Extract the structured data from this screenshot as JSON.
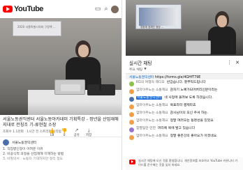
{
  "left": {
    "brand": "YouTube",
    "banner": "2020 서울특별시의회 구정책 ...",
    "title": "서울노동권익센터 서울노동아카데미 기획특강 - 정년을 산업재해 지대로 전칭조 기-류현철 소장",
    "meta": "조회수 1.1천회 · 1시간 전 스트리밍 시작됨",
    "actions": [
      {
        "glyph": "👍",
        "label": "18"
      },
      {
        "glyph": "👎",
        "label": "0"
      },
      {
        "glyph": "↗",
        "label": "공유"
      },
      {
        "glyph": "⤓",
        "label": "저장"
      }
    ],
    "desc_channel": "서울노동권익센터",
    "desc_lines": [
      "1. 직업병인정이 어려운 이유",
      "2. 비공식적 과정을 산업재해 이해하는 방법",
      "3. 비질의서 : 노동자 기대하지만 정리 정도"
    ]
  },
  "right": {
    "screen_text": "정동에 정해진 청정 ...",
    "chat": {
      "title": "실시간 채팅",
      "subtitle": "주요 채팅",
      "pinned_channel": "서울노동권익센터",
      "pinned_text": "https://forms.gle/4GHfT79E",
      "messages": [
        {
          "author": "KG의 여행자 레디오",
          "text": "반갑습니다. 잘부탁드립니다",
          "style": "normal",
          "color": "#8bc34a"
        },
        {
          "author": "엄마이주노는 소통해요",
          "text": "감자기 노예가되어버리신분이라는",
          "style": "normal",
          "color": "#f0a04b"
        },
        {
          "author": "서울노동권익센터",
          "text": "네 사정에 올려보 도록 하겠습니다.",
          "style": "owner",
          "color": "#4b6fa8"
        },
        {
          "author": "엄마이주노는 소통해요",
          "text": "목표라라 결제라죠",
          "style": "normal",
          "color": "#f0a04b"
        },
        {
          "author": "엄마이주노는 소통해요",
          "text": "감사님이의 모신 주셔 하는.",
          "style": "normal",
          "color": "#f0a04b"
        },
        {
          "author": "엄마이주노는 소통해요",
          "text": "정말 여러모는 동명성을 있었요",
          "style": "normal",
          "color": "#f0a04b"
        },
        {
          "author": "참딸팀만 만한",
          "text": "머리에 목에 발고 있습니다",
          "style": "normal",
          "color": "#9575cd"
        },
        {
          "author": "엄마이주노는 소통해요",
          "text": "정말 좋은강의 좋아요가 아겠네요.",
          "style": "normal",
          "color": "#f0a04b"
        }
      ],
      "footer": "실시간 채팅에 오신 것을 환영합니다. 개인정보를 보호하고 YouTube 커뮤니티 가이드를 준수해는 것을 잊지 마세요."
    }
  }
}
